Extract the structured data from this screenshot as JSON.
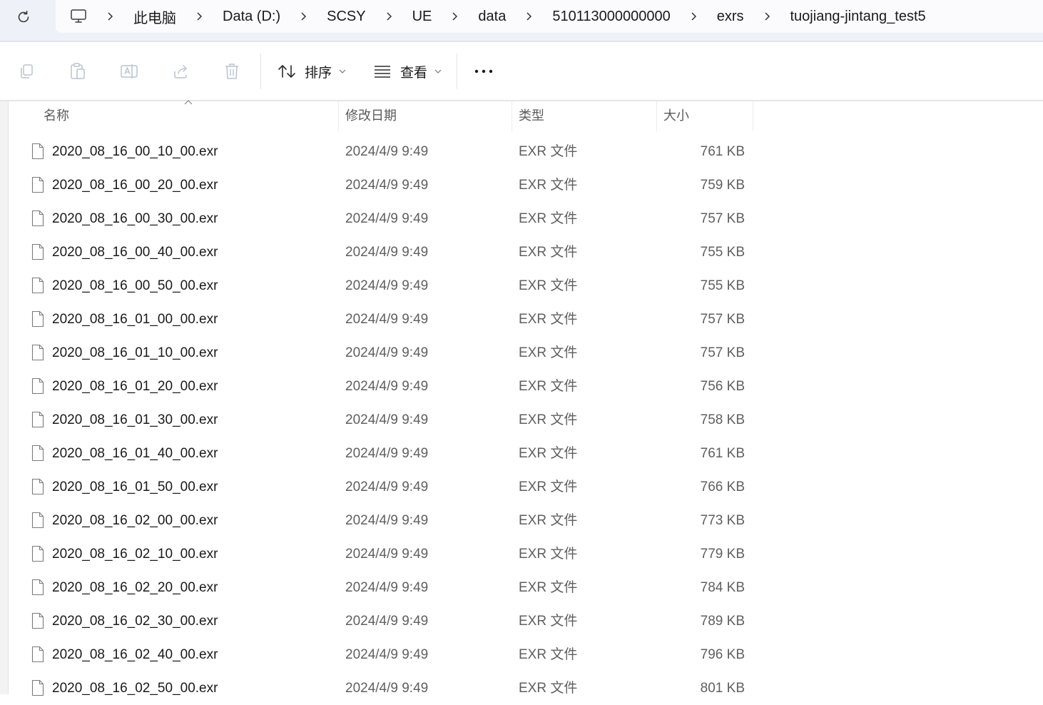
{
  "breadcrumb": {
    "items": [
      "此电脑",
      "Data (D:)",
      "SCSY",
      "UE",
      "data",
      "510113000000000",
      "exrs",
      "tuojiang-jintang_test5"
    ]
  },
  "toolbar": {
    "sort_label": "排序",
    "view_label": "查看"
  },
  "columns": {
    "name": "名称",
    "date": "修改日期",
    "type": "类型",
    "size": "大小"
  },
  "files": [
    {
      "name": "2020_08_16_00_10_00.exr",
      "date": "2024/4/9 9:49",
      "type": "EXR 文件",
      "size": "761 KB"
    },
    {
      "name": "2020_08_16_00_20_00.exr",
      "date": "2024/4/9 9:49",
      "type": "EXR 文件",
      "size": "759 KB"
    },
    {
      "name": "2020_08_16_00_30_00.exr",
      "date": "2024/4/9 9:49",
      "type": "EXR 文件",
      "size": "757 KB"
    },
    {
      "name": "2020_08_16_00_40_00.exr",
      "date": "2024/4/9 9:49",
      "type": "EXR 文件",
      "size": "755 KB"
    },
    {
      "name": "2020_08_16_00_50_00.exr",
      "date": "2024/4/9 9:49",
      "type": "EXR 文件",
      "size": "755 KB"
    },
    {
      "name": "2020_08_16_01_00_00.exr",
      "date": "2024/4/9 9:49",
      "type": "EXR 文件",
      "size": "757 KB"
    },
    {
      "name": "2020_08_16_01_10_00.exr",
      "date": "2024/4/9 9:49",
      "type": "EXR 文件",
      "size": "757 KB"
    },
    {
      "name": "2020_08_16_01_20_00.exr",
      "date": "2024/4/9 9:49",
      "type": "EXR 文件",
      "size": "756 KB"
    },
    {
      "name": "2020_08_16_01_30_00.exr",
      "date": "2024/4/9 9:49",
      "type": "EXR 文件",
      "size": "758 KB"
    },
    {
      "name": "2020_08_16_01_40_00.exr",
      "date": "2024/4/9 9:49",
      "type": "EXR 文件",
      "size": "761 KB"
    },
    {
      "name": "2020_08_16_01_50_00.exr",
      "date": "2024/4/9 9:49",
      "type": "EXR 文件",
      "size": "766 KB"
    },
    {
      "name": "2020_08_16_02_00_00.exr",
      "date": "2024/4/9 9:49",
      "type": "EXR 文件",
      "size": "773 KB"
    },
    {
      "name": "2020_08_16_02_10_00.exr",
      "date": "2024/4/9 9:49",
      "type": "EXR 文件",
      "size": "779 KB"
    },
    {
      "name": "2020_08_16_02_20_00.exr",
      "date": "2024/4/9 9:49",
      "type": "EXR 文件",
      "size": "784 KB"
    },
    {
      "name": "2020_08_16_02_30_00.exr",
      "date": "2024/4/9 9:49",
      "type": "EXR 文件",
      "size": "789 KB"
    },
    {
      "name": "2020_08_16_02_40_00.exr",
      "date": "2024/4/9 9:49",
      "type": "EXR 文件",
      "size": "796 KB"
    },
    {
      "name": "2020_08_16_02_50_00.exr",
      "date": "2024/4/9 9:49",
      "type": "EXR 文件",
      "size": "801 KB"
    }
  ]
}
